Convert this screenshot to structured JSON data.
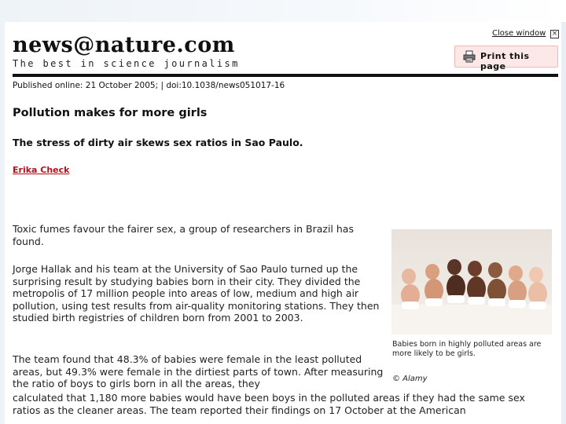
{
  "header": {
    "logo_title": "news@nature.com",
    "logo_tagline": "The best in science journalism",
    "close_label": "Close window",
    "close_icon": "close-icon",
    "print_label": "Print this page",
    "print_icon": "printer-icon"
  },
  "article": {
    "published": "Published online: 21 October 2005; | doi:10.1038/news051017-16",
    "headline": "Pollution makes for more girls",
    "subheadline": "The stress of dirty air skews sex ratios in Sao Paulo.",
    "author": "Erika Check",
    "paragraphs": [
      "Toxic fumes favour the fairer sex, a group of researchers in Brazil has found.",
      "Jorge Hallak and his team at the University of Sao Paulo turned up the surprising result by studying babies born in their city. They divided the metropolis of 17 million people into areas of low, medium and high air pollution, using test results from air-quality monitoring stations. They then studied birth registries of children born from 2001 to 2003.",
      "The team found that 48.3% of babies were female in the least polluted areas, but 49.3% were female in the dirtiest parts of town. After measuring the ratio of boys to girls born in all the areas, they",
      "calculated that 1,180 more babies would have been boys in the polluted areas if they had the same sex ratios as the cleaner areas. The team reported their findings on 17 October at the American"
    ]
  },
  "image": {
    "caption": "Babies born in highly polluted areas are more likely to be girls.",
    "credit": "© Alamy"
  },
  "colors": {
    "author_link": "#b3121a",
    "print_button_bg": "#fde8e8",
    "rule": "#111111"
  }
}
